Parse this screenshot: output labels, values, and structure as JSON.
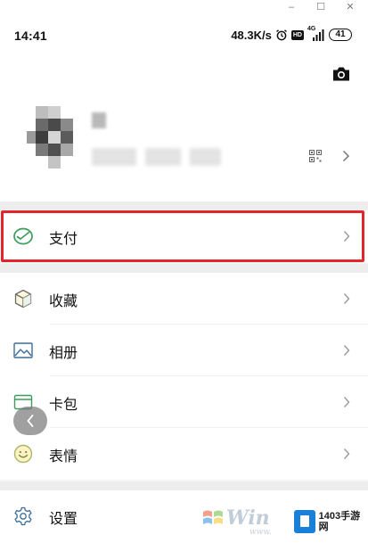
{
  "window": {
    "minimize_glyph": "–",
    "maximize_glyph": "☐",
    "close_glyph": "✕"
  },
  "status": {
    "time": "14:41",
    "speed": "48.3K/s",
    "network": "4G",
    "hd": "HD",
    "battery": "41",
    "icons": [
      "alarm-icon",
      "hd-icon",
      "signal-icon",
      "battery-icon"
    ]
  },
  "profile": {
    "camera_icon": "camera-icon",
    "qr_icon": "qr-code-icon"
  },
  "menu": {
    "pay": {
      "label": "支付",
      "icon": "wallet-icon"
    },
    "favorites": {
      "label": "收藏",
      "icon": "cube-icon"
    },
    "album": {
      "label": "相册",
      "icon": "image-icon"
    },
    "cards": {
      "label": "卡包",
      "icon": "card-icon"
    },
    "stickers": {
      "label": "表情",
      "icon": "smiley-icon"
    },
    "settings": {
      "label": "设置",
      "icon": "gear-icon"
    }
  },
  "colors": {
    "highlight": "#e3262b",
    "icon_green": "#3b9c5c",
    "watermark_blue": "#1a7fd8"
  },
  "watermark": {
    "win_text": "Win",
    "win_sub": "www.",
    "site": "1403手游网"
  }
}
